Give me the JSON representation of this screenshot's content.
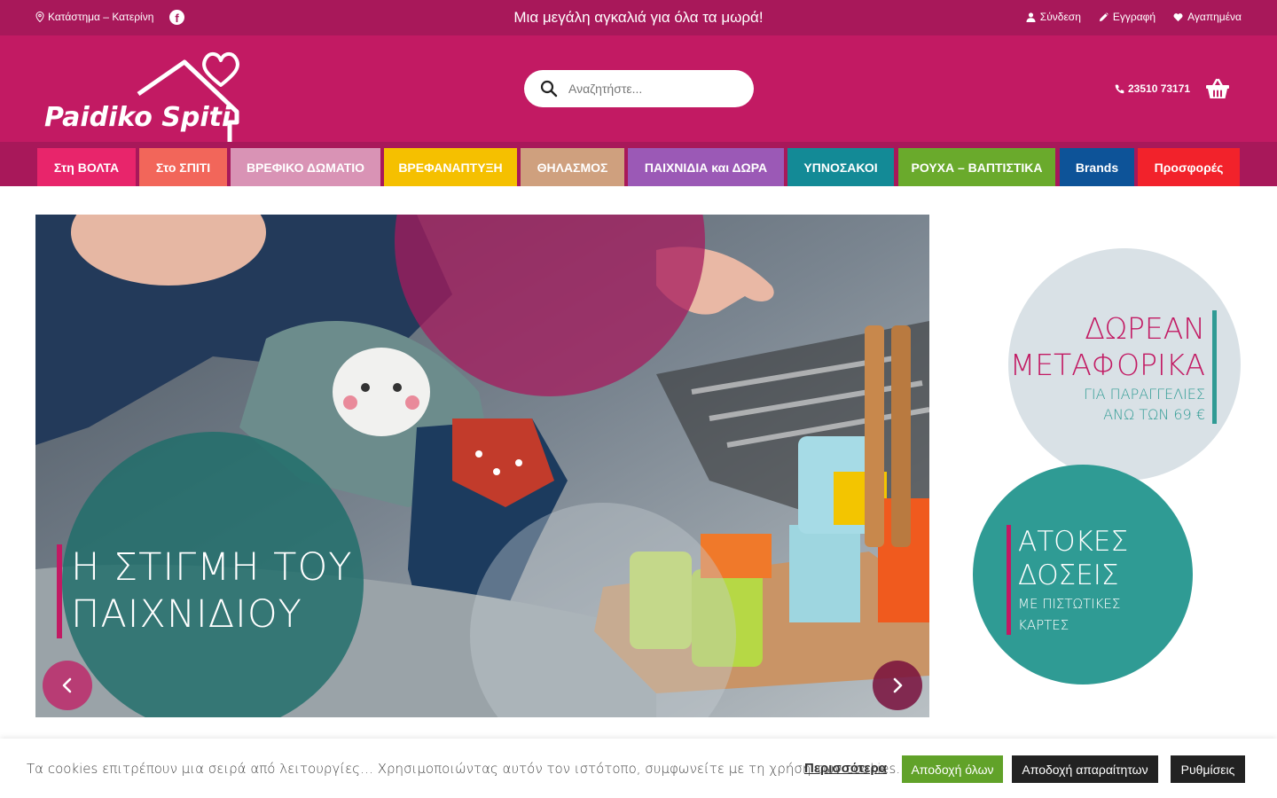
{
  "topbar": {
    "store_location": "Κατάστημα – Κατερίνη",
    "tagline": "Μια μεγάλη αγκαλιά για όλα τα μωρά!",
    "login": "Σύνδεση",
    "register": "Εγγραφή",
    "wishlist": "Αγαπημένα"
  },
  "header": {
    "logo_text": "Paidiko Spiti",
    "search_placeholder": "Αναζητήστε...",
    "phone": "23510 73171"
  },
  "nav": {
    "items": [
      {
        "label": "Στη ΒΟΛΤΑ",
        "color": "#e8256b"
      },
      {
        "label": "Στο ΣΠΙΤΙ",
        "color": "#f2665a"
      },
      {
        "label": "ΒΡΕΦΙΚΟ ΔΩΜΑΤΙΟ",
        "color": "#d993b5"
      },
      {
        "label": "ΒΡΕΦΑΝΑΠΤΥΞΗ",
        "color": "#f5c000"
      },
      {
        "label": "ΘΗΛΑΣΜΟΣ",
        "color": "#cfa07e"
      },
      {
        "label": "ΠΑΙΧΝΙΔΙΑ και ΔΩΡΑ",
        "color": "#9b59b6"
      },
      {
        "label": "ΥΠΝΟΣΑΚΟΙ",
        "color": "#138a96"
      },
      {
        "label": "ΡΟΥΧΑ – ΒΑΠΤΙΣΤΙΚΑ",
        "color": "#6aaa2c"
      },
      {
        "label": "Brands",
        "color": "#0d5398"
      },
      {
        "label": "Προσφορές",
        "color": "#f2222b"
      }
    ]
  },
  "slider": {
    "caption_line1": "Η ΣΤΙΓΜΗ ΤΟΥ",
    "caption_line2": "ΠΑΙΧΝΙΔΙΟΥ"
  },
  "promos": {
    "shipping_line1": "ΔΩΡΕΑΝ",
    "shipping_line2": "ΜΕΤΑΦΟΡΙΚΑ",
    "shipping_line3": "ΓΙΑ ΠΑΡΑΓΓΕΛΙΕΣ",
    "shipping_line4": "ΑΝΩ ΤΩΝ 69 €",
    "installments_line1": "ΑΤΟΚΕΣ",
    "installments_line2": "ΔΟΣΕΙΣ",
    "installments_line3": "ΜΕ ΠΙΣΤΩΤΙΚΕΣ",
    "installments_line4": "ΚΑΡΤΕΣ"
  },
  "cookie": {
    "message": "Τα cookies επιτρέπουν μια σειρά από λειτουργίες… Χρησιμοποιώντας αυτόν τον ιστότοπο, συμφωνείτε με τη χρήση των cookies.",
    "more": "Περισσότερα",
    "accept_all": "Αποδοχή όλων",
    "accept_necessary": "Αποδοχή απαραίτητων",
    "settings": "Ρυθμίσεις"
  },
  "colors": {
    "topbar": "#a8185a",
    "header": "#c21a63",
    "teal": "#2f9b94",
    "cookie_accept": "#61a229"
  }
}
